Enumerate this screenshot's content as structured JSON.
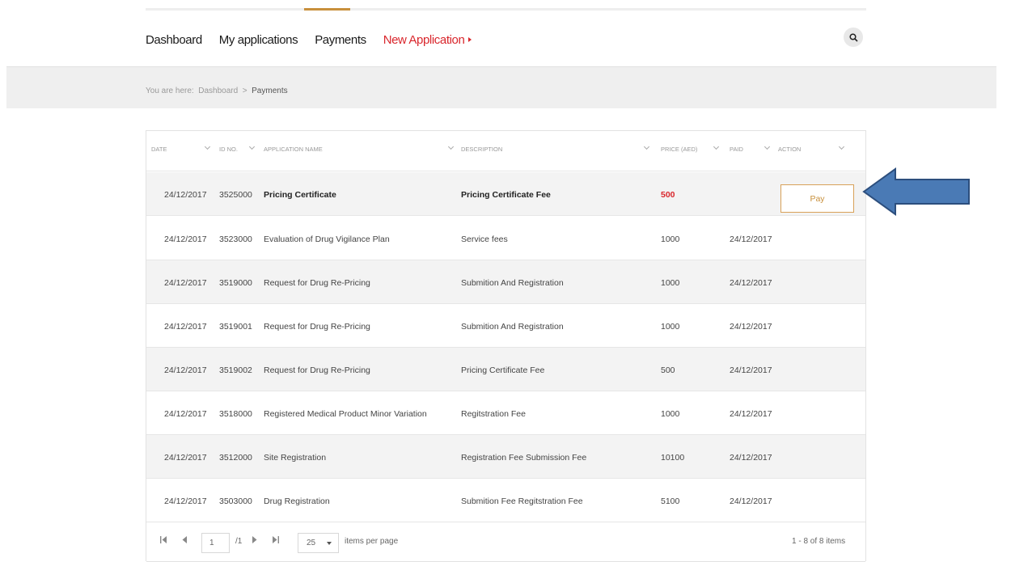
{
  "nav": {
    "items": [
      "Dashboard",
      "My applications",
      "Payments"
    ],
    "new_application": "New Application"
  },
  "breadcrumb": {
    "prefix": "You are here:",
    "home": "Dashboard",
    "separator": ">",
    "current": "Payments"
  },
  "table": {
    "columns": [
      "DATE",
      "ID NO.",
      "APPLICATION NAME",
      "DESCRIPTION",
      "PRICE (AED)",
      "PAID",
      "ACTION"
    ],
    "rows": [
      {
        "date": "24/12/2017",
        "id": "3525000",
        "name": "Pricing Certificate",
        "desc": "Pricing Certificate Fee",
        "price": "500",
        "paid": "",
        "action": "Pay"
      },
      {
        "date": "24/12/2017",
        "id": "3523000",
        "name": "Evaluation of Drug Vigilance Plan",
        "desc": "Service fees",
        "price": "1000",
        "paid": "24/12/2017"
      },
      {
        "date": "24/12/2017",
        "id": "3519000",
        "name": "Request for Drug Re-Pricing",
        "desc": "Submition And Registration",
        "price": "1000",
        "paid": "24/12/2017"
      },
      {
        "date": "24/12/2017",
        "id": "3519001",
        "name": "Request for Drug Re-Pricing",
        "desc": "Submition And Registration",
        "price": "1000",
        "paid": "24/12/2017"
      },
      {
        "date": "24/12/2017",
        "id": "3519002",
        "name": "Request for Drug Re-Pricing",
        "desc": "Pricing Certificate Fee",
        "price": "500",
        "paid": "24/12/2017"
      },
      {
        "date": "24/12/2017",
        "id": "3518000",
        "name": "Registered Medical Product Minor Variation",
        "desc": "Regitstration Fee",
        "price": "1000",
        "paid": "24/12/2017"
      },
      {
        "date": "24/12/2017",
        "id": "3512000",
        "name": "Site Registration",
        "desc": "Registration Fee Submission Fee",
        "price": "10100",
        "paid": "24/12/2017"
      },
      {
        "date": "24/12/2017",
        "id": "3503000",
        "name": "Drug Registration",
        "desc": "Submition Fee Regitstration Fee",
        "price": "5100",
        "paid": "24/12/2017"
      }
    ]
  },
  "pager": {
    "page": "1",
    "of_pages": "/1",
    "page_size": "25",
    "items_per_page": "items per page",
    "summary": "1 - 8 of 8 items"
  },
  "colors": {
    "accent": "#c8903c",
    "new_application": "#d9262c",
    "arrow": "#4a7ab5"
  }
}
